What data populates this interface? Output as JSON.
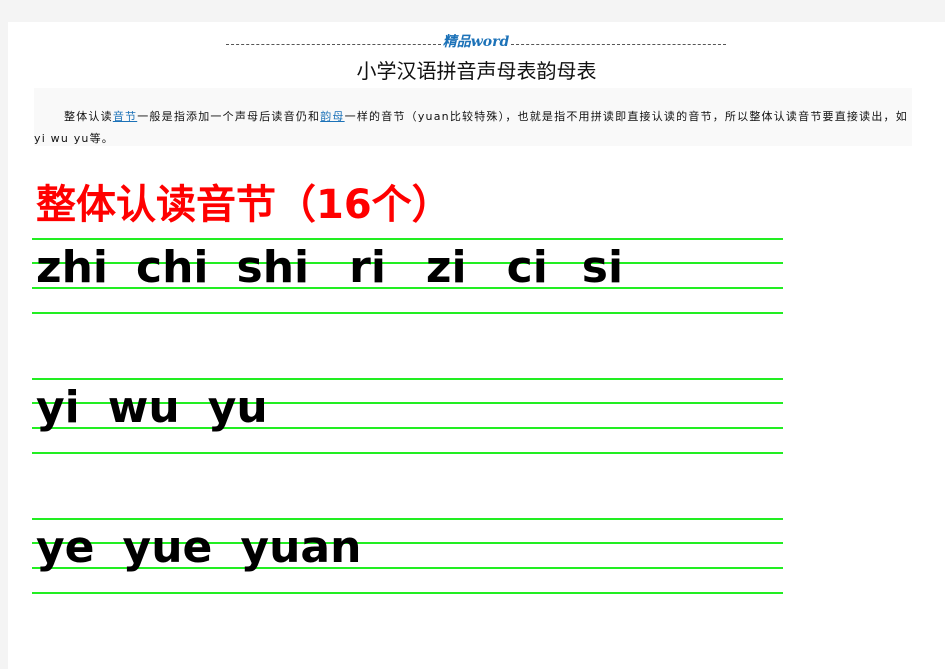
{
  "header": {
    "brand": "精品word"
  },
  "document": {
    "title": "小学汉语拼音声母表韵母表",
    "intro": {
      "part1": "整体认读",
      "link1": "音节",
      "part2": "一般是指添加一个声母后读音仍和",
      "link2": "韵母",
      "part3": "一样的音节（yuan比较特殊），也就是指不用拼读即直接认读的音节，所以整体认读音节要直接读出，如yi wu yu等。"
    },
    "section_title": "整体认读音节（16个）",
    "rows": [
      {
        "syllables": [
          "zhi",
          "chi",
          "shi",
          "ri",
          "zi",
          "ci",
          "si"
        ]
      },
      {
        "syllables": [
          "yi",
          "wu",
          "yu"
        ]
      },
      {
        "syllables": [
          "ye",
          "yue",
          "yuan"
        ]
      }
    ]
  },
  "colors": {
    "section_title": "#ff0000",
    "guide_lines": "#22ee22",
    "link": "#1c72b8"
  }
}
